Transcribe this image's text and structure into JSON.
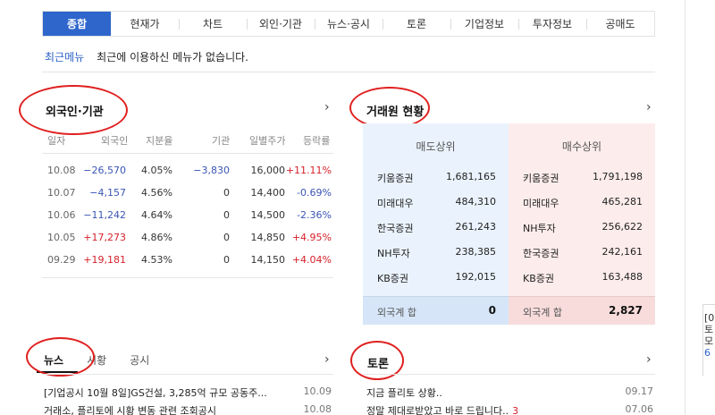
{
  "tabs": [
    "종합",
    "현재가",
    "차트",
    "외인·기관",
    "뉴스·공시",
    "토론",
    "기업정보",
    "투자정보",
    "공매도"
  ],
  "recent_menu": {
    "label": "최근메뉴",
    "message": "최근에 이용하신 메뉴가 없습니다."
  },
  "foreign_section": {
    "title": "외국인·기관",
    "more_icon": "chevron-right-icon",
    "columns": [
      "일자",
      "외국인",
      "지분율",
      "기관",
      "일별주가",
      "등락률"
    ],
    "rows": [
      {
        "date": "10.08",
        "foreign": "−26,570",
        "ratio": "4.05%",
        "inst": "−3,830",
        "price": "16,000",
        "change": "+11.11%",
        "fdir": "neg",
        "idir": "neg",
        "cdir": "pos"
      },
      {
        "date": "10.07",
        "foreign": "−4,157",
        "ratio": "4.56%",
        "inst": "0",
        "price": "14,400",
        "change": "-0.69%",
        "fdir": "neg",
        "idir": "neu",
        "cdir": "neg"
      },
      {
        "date": "10.06",
        "foreign": "−11,242",
        "ratio": "4.64%",
        "inst": "0",
        "price": "14,500",
        "change": "-2.36%",
        "fdir": "neg",
        "idir": "neu",
        "cdir": "neg"
      },
      {
        "date": "10.05",
        "foreign": "+17,273",
        "ratio": "4.86%",
        "inst": "0",
        "price": "14,850",
        "change": "+4.95%",
        "fdir": "pos",
        "idir": "neu",
        "cdir": "pos"
      },
      {
        "date": "09.29",
        "foreign": "+19,181",
        "ratio": "4.53%",
        "inst": "0",
        "price": "14,150",
        "change": "+4.04%",
        "fdir": "pos",
        "idir": "neu",
        "cdir": "pos"
      }
    ]
  },
  "broker_section": {
    "title": "거래원 현황",
    "more_icon": "chevron-right-icon",
    "sell": {
      "header": "매도상위",
      "rows": [
        {
          "name": "키움증권",
          "value": "1,681,165"
        },
        {
          "name": "미래대우",
          "value": "484,310"
        },
        {
          "name": "한국증권",
          "value": "261,243"
        },
        {
          "name": "NH투자",
          "value": "238,385"
        },
        {
          "name": "KB증권",
          "value": "192,015"
        }
      ],
      "sum_label": "외국계 합",
      "sum_value": "0"
    },
    "buy": {
      "header": "매수상위",
      "rows": [
        {
          "name": "키움증권",
          "value": "1,791,198"
        },
        {
          "name": "미래대우",
          "value": "465,281"
        },
        {
          "name": "NH투자",
          "value": "256,622"
        },
        {
          "name": "한국증권",
          "value": "242,161"
        },
        {
          "name": "KB증권",
          "value": "163,488"
        }
      ],
      "sum_label": "외국계 합",
      "sum_value": "2,827"
    }
  },
  "news_section": {
    "tabs": [
      "뉴스",
      "시황",
      "공시"
    ],
    "more_icon": "chevron-right-icon",
    "items": [
      {
        "title": "[기업공시 10월 8일]GS건설, 3,285억 규모 공동주...",
        "date": "10.09"
      },
      {
        "title": "거래소, 플리토에 시황 변동 관련 조회공시",
        "date": "10.08"
      }
    ]
  },
  "discussion_section": {
    "title": "토론",
    "more_icon": "chevron-right-icon",
    "items": [
      {
        "title": "지금 플리토 상황..",
        "count": "",
        "date": "09.17"
      },
      {
        "title": "정말 제대로받았고 바로 드립니다..",
        "count": "3",
        "date": "07.06"
      }
    ]
  },
  "right_fragment": [
    "[0",
    "토",
    "모",
    "6"
  ],
  "colors": {
    "accent": "#2e66cc",
    "positive": "#d6202a",
    "negative": "#3a55b5",
    "annotation": "#e02020",
    "sell_bg": "#eaf3fd",
    "buy_bg": "#fdecec"
  }
}
